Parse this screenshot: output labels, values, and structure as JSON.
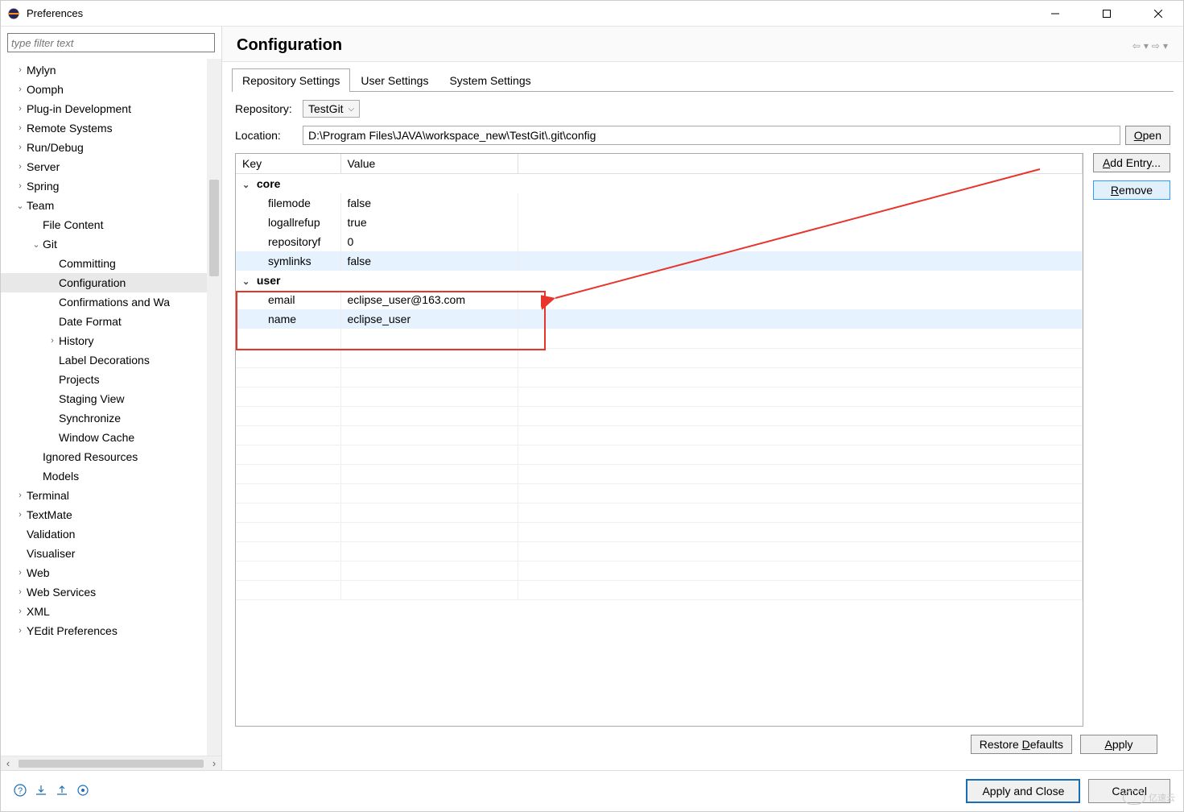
{
  "window": {
    "title": "Preferences"
  },
  "filter": {
    "placeholder": "type filter text"
  },
  "tree": [
    {
      "label": "Mylyn",
      "level": 1,
      "chev": ">"
    },
    {
      "label": "Oomph",
      "level": 1,
      "chev": ">"
    },
    {
      "label": "Plug-in Development",
      "level": 1,
      "chev": ">"
    },
    {
      "label": "Remote Systems",
      "level": 1,
      "chev": ">"
    },
    {
      "label": "Run/Debug",
      "level": 1,
      "chev": ">"
    },
    {
      "label": "Server",
      "level": 1,
      "chev": ">"
    },
    {
      "label": "Spring",
      "level": 1,
      "chev": ">"
    },
    {
      "label": "Team",
      "level": 1,
      "chev": "v"
    },
    {
      "label": "File Content",
      "level": 2,
      "chev": ""
    },
    {
      "label": "Git",
      "level": 2,
      "chev": "v"
    },
    {
      "label": "Committing",
      "level": 3,
      "chev": ""
    },
    {
      "label": "Configuration",
      "level": 3,
      "chev": "",
      "selected": true
    },
    {
      "label": "Confirmations and Wa",
      "level": 3,
      "chev": ""
    },
    {
      "label": "Date Format",
      "level": 3,
      "chev": ""
    },
    {
      "label": "History",
      "level": 3,
      "chev": ">"
    },
    {
      "label": "Label Decorations",
      "level": 3,
      "chev": ""
    },
    {
      "label": "Projects",
      "level": 3,
      "chev": ""
    },
    {
      "label": "Staging View",
      "level": 3,
      "chev": ""
    },
    {
      "label": "Synchronize",
      "level": 3,
      "chev": ""
    },
    {
      "label": "Window Cache",
      "level": 3,
      "chev": ""
    },
    {
      "label": "Ignored Resources",
      "level": 2,
      "chev": ""
    },
    {
      "label": "Models",
      "level": 2,
      "chev": ""
    },
    {
      "label": "Terminal",
      "level": 1,
      "chev": ">"
    },
    {
      "label": "TextMate",
      "level": 1,
      "chev": ">"
    },
    {
      "label": "Validation",
      "level": 1,
      "chev": ""
    },
    {
      "label": "Visualiser",
      "level": 1,
      "chev": ""
    },
    {
      "label": "Web",
      "level": 1,
      "chev": ">"
    },
    {
      "label": "Web Services",
      "level": 1,
      "chev": ">"
    },
    {
      "label": "XML",
      "level": 1,
      "chev": ">"
    },
    {
      "label": "YEdit Preferences",
      "level": 1,
      "chev": ">"
    }
  ],
  "page": {
    "title": "Configuration",
    "tabs": [
      "Repository Settings",
      "User Settings",
      "System Settings"
    ],
    "active_tab": 0,
    "repository_label": "Repository:",
    "repository_value": "TestGit",
    "location_label": "Location:",
    "location_value": "D:\\Program Files\\JAVA\\workspace_new\\TestGit\\.git\\config",
    "open_label": "Open",
    "table": {
      "headers": [
        "Key",
        "Value"
      ],
      "groups": [
        {
          "name": "core",
          "rows": [
            {
              "key": "filemode",
              "value": "false"
            },
            {
              "key": "logallrefupdates",
              "value": "true"
            },
            {
              "key": "repositoryformatversion",
              "value": "0"
            },
            {
              "key": "symlinks",
              "value": "false",
              "highlight": true
            }
          ]
        },
        {
          "name": "user",
          "rows": [
            {
              "key": "email",
              "value": "eclipse_user@163.com"
            },
            {
              "key": "name",
              "value": "eclipse_user",
              "highlight": true
            }
          ]
        }
      ]
    },
    "add_entry_label": "Add Entry...",
    "remove_label": "Remove",
    "restore_defaults_label": "Restore Defaults",
    "apply_label": "Apply"
  },
  "footer": {
    "apply_close_label": "Apply and Close",
    "cancel_label": "Cancel"
  },
  "watermark": {
    "text": "亿速云"
  }
}
